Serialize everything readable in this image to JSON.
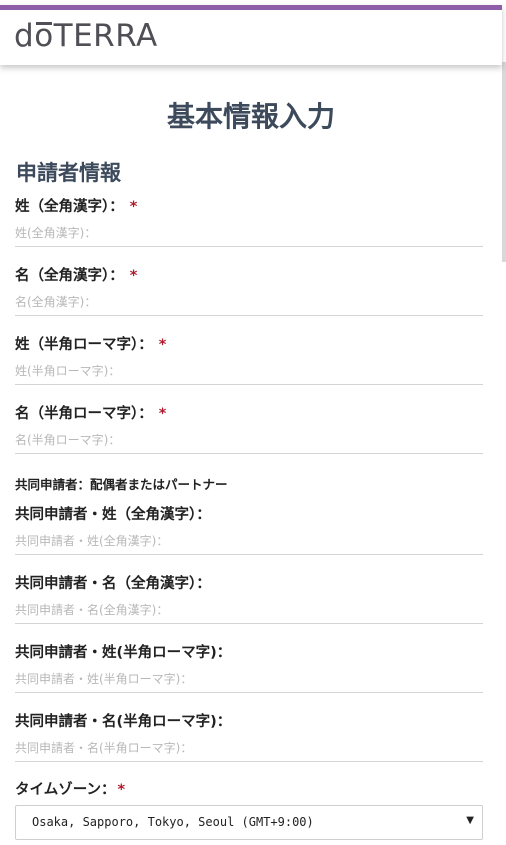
{
  "header": {
    "logo_text_prefix": "d",
    "logo_text_o": "o",
    "logo_text_suffix": "TERRA"
  },
  "page": {
    "title": "基本情報入力"
  },
  "section": {
    "title": "申請者情報"
  },
  "fields": [
    {
      "label": "姓（全角漢字）：",
      "required": "*",
      "placeholder": "姓(全角漢字)："
    },
    {
      "label": "名（全角漢字）：",
      "required": "*",
      "placeholder": "名(全角漢字)："
    },
    {
      "label": "姓（半角ローマ字）：",
      "required": "*",
      "placeholder": "姓(半角ローマ字)："
    },
    {
      "label": "名（半角ローマ字）：",
      "required": "*",
      "placeholder": "名(半角ローマ字)："
    }
  ],
  "co_applicant": {
    "note": "共同申請者：配偶者またはパートナー",
    "fields": [
      {
        "label": "共同申請者・姓（全角漢字）：",
        "placeholder": "共同申請者・姓(全角漢字)："
      },
      {
        "label": "共同申請者・名（全角漢字）：",
        "placeholder": "共同申請者・名(全角漢字)："
      },
      {
        "label": "共同申請者・姓(半角ローマ字)：",
        "placeholder": "共同申請者・姓(半角ローマ字)："
      },
      {
        "label": "共同申請者・名(半角ローマ字)：",
        "placeholder": "共同申請者・名(半角ローマ字)："
      }
    ]
  },
  "timezone": {
    "label": "タイムゾーン：",
    "required": "*",
    "selected": "Osaka, Sapporo, Tokyo, Seoul (GMT+9:00)"
  },
  "colors": {
    "accent_bar": "#8f5ea8",
    "required_mark": "#b01c2e",
    "title": "#3d4a5c"
  }
}
